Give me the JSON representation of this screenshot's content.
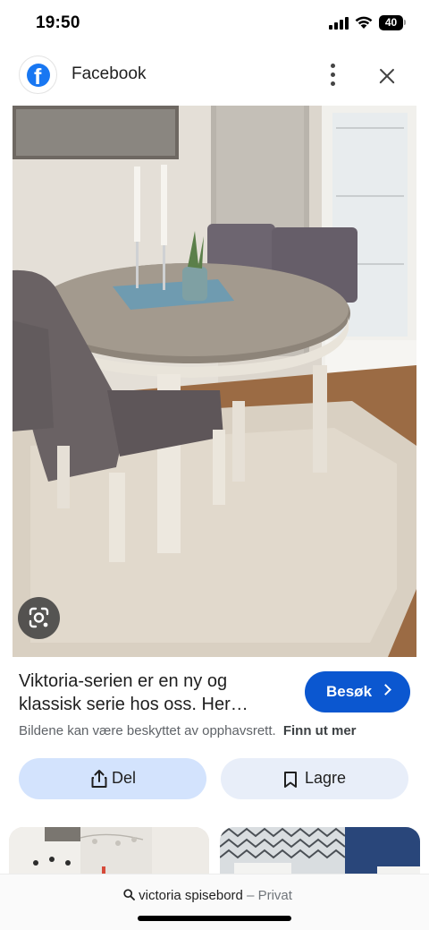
{
  "status_bar": {
    "time": "19:50",
    "battery_level": "40",
    "icons": [
      "cellular-signal-icon",
      "wifi-icon",
      "battery-icon"
    ]
  },
  "source": {
    "title": "Facebook",
    "logo_letter": "f",
    "icons": [
      "facebook-logo-icon",
      "more-vert-icon",
      "close-icon"
    ]
  },
  "image": {
    "lens_icon": "google-lens-icon"
  },
  "result": {
    "caption_line1": "Viktoria-serien er en ny og",
    "caption_line2": "klassisk serie hos oss. Her…",
    "visit_label": "Besøk",
    "copyright_text": "Bildene kan være beskyttet av opphavsrett.",
    "learn_more": "Finn ut mer"
  },
  "actions": {
    "share_label": "Del",
    "save_label": "Lagre"
  },
  "search": {
    "query": "victoria spisebord",
    "separator": "–",
    "mode": "Privat"
  },
  "colors": {
    "accent_blue": "#0b57d0",
    "share_bg": "#d3e3fd",
    "save_bg": "#e8eef9",
    "facebook_blue": "#1877f2"
  }
}
